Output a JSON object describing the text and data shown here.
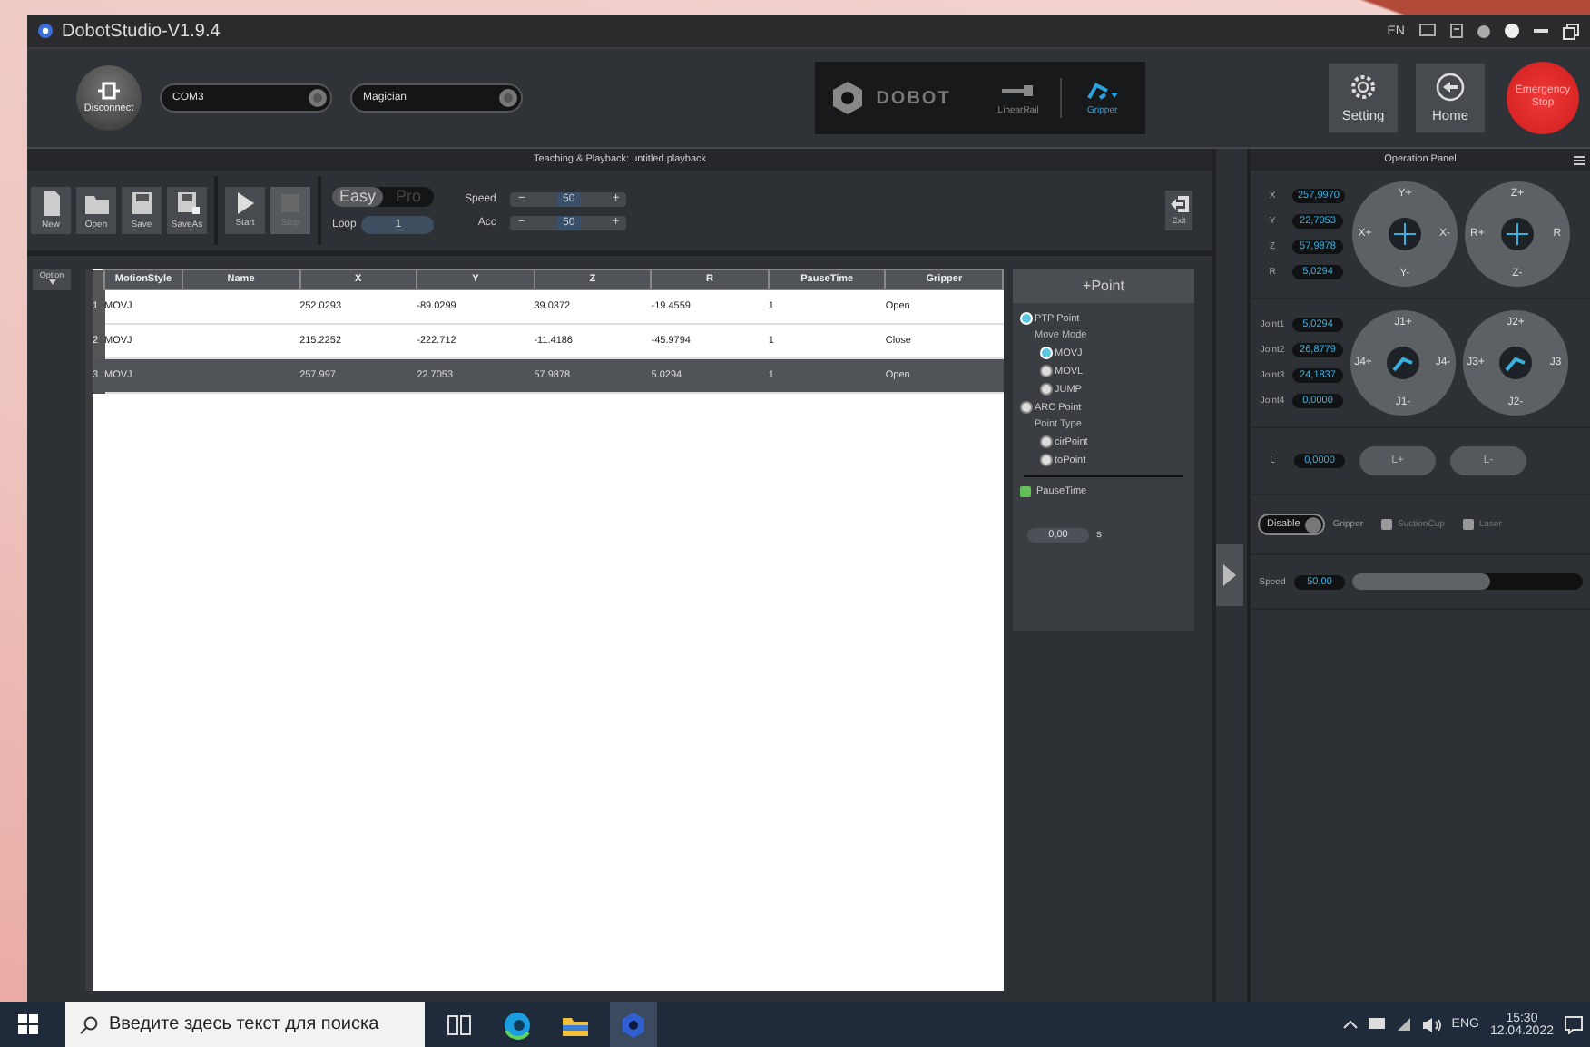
{
  "window": {
    "title": "DobotStudio-V1.9.4",
    "language": "EN"
  },
  "toolbar": {
    "connect_button": "Disconnect",
    "port": "COM3",
    "device": "Magician",
    "brand": "DOBOT",
    "end_effectors": [
      {
        "label": "LinearRail",
        "kind": "rail",
        "selected": false
      },
      {
        "label": "Gripper",
        "kind": "gripper",
        "selected": true
      }
    ],
    "buttons": [
      {
        "label": "Setting",
        "kind": "gear"
      },
      {
        "label": "Home",
        "kind": "home"
      }
    ],
    "emergency_stop": "Emergency Stop"
  },
  "teaching": {
    "title": "Teaching & Playback: untitled.playback",
    "file_buttons": [
      {
        "label": "New",
        "kind": "new"
      },
      {
        "label": "Open",
        "kind": "open"
      },
      {
        "label": "Save",
        "kind": "save"
      },
      {
        "label": "SaveAs",
        "kind": "saveas"
      }
    ],
    "run_buttons": [
      {
        "label": "Start",
        "kind": "play",
        "disabled": false
      },
      {
        "label": "Stop",
        "kind": "stop",
        "disabled": true
      }
    ],
    "modes": [
      {
        "label": "Easy",
        "selected": true
      },
      {
        "label": "Pro",
        "selected": false
      }
    ],
    "loop": {
      "label": "Loop",
      "value": "1"
    },
    "steppers": [
      {
        "label": "Speed",
        "minus": "−",
        "value": "50",
        "plus": "+"
      },
      {
        "label": "Acc",
        "minus": "−",
        "value": "50",
        "plus": "+"
      }
    ],
    "exit": "Exit",
    "option": "Option",
    "table": {
      "columns": [
        "MotionStyle",
        "Name",
        "X",
        "Y",
        "Z",
        "R",
        "PauseTime",
        "Gripper"
      ],
      "rows": [
        {
          "index": "1",
          "cells": [
            "MOVJ",
            "",
            "252.0293",
            "-89.0299",
            "39.0372",
            "-19.4559",
            "1",
            "Open"
          ],
          "selected": false
        },
        {
          "index": "2",
          "cells": [
            "MOVJ",
            "",
            "215.2252",
            "-222.712",
            "-11.4186",
            "-45.9794",
            "1",
            "Close"
          ],
          "selected": false
        },
        {
          "index": "3",
          "cells": [
            "MOVJ",
            "",
            "257.997",
            "22.7053",
            "57.9878",
            "5.0294",
            "1",
            "Open"
          ],
          "selected": true
        }
      ]
    },
    "point_panel": {
      "add_button": "+Point",
      "groups": [
        {
          "label": "PTP Point",
          "selected": true,
          "caption": "Move Mode",
          "children": [
            {
              "label": "MOVJ",
              "selected": true
            },
            {
              "label": "MOVL",
              "selected": false
            },
            {
              "label": "JUMP",
              "selected": false
            }
          ]
        },
        {
          "label": "ARC Point",
          "selected": false,
          "caption": "Point Type",
          "children": [
            {
              "label": "cirPoint",
              "selected": false
            },
            {
              "label": "toPoint",
              "selected": false
            }
          ]
        }
      ],
      "pause": {
        "label": "PauseTime",
        "checked": true,
        "value": "0,00",
        "unit": "s"
      }
    }
  },
  "operation_panel": {
    "title": "Operation Panel",
    "coords": [
      {
        "label": "X",
        "value": "257,9970"
      },
      {
        "label": "Y",
        "value": "22,7053"
      },
      {
        "label": "Z",
        "value": "57,9878"
      },
      {
        "label": "R",
        "value": "5,0294"
      }
    ],
    "coord_wheels": [
      {
        "top": "Y+",
        "left": "X+",
        "right": "X-",
        "bottom": "Y-"
      },
      {
        "top": "Z+",
        "left": "R+",
        "right": "R",
        "bottom": "Z-"
      }
    ],
    "joints": [
      {
        "label": "Joint1",
        "value": "5,0294"
      },
      {
        "label": "Joint2",
        "value": "26,8779"
      },
      {
        "label": "Joint3",
        "value": "24,1837"
      },
      {
        "label": "Joint4",
        "value": "0,0000"
      }
    ],
    "joint_wheels": [
      {
        "top": "J1+",
        "left": "J4+",
        "right": "J4-",
        "bottom": "J1-"
      },
      {
        "top": "J2+",
        "left": "J3+",
        "right": "J3",
        "bottom": "J2-"
      }
    ],
    "rail": {
      "label": "L",
      "value": "0,0000",
      "buttons": [
        "L+",
        "L-"
      ]
    },
    "gripper": {
      "toggle": "Disable",
      "on": false,
      "label": "Gripper",
      "options": [
        {
          "label": "SuctionCup",
          "checked": false
        },
        {
          "label": "Laser",
          "checked": false
        }
      ]
    },
    "speed": {
      "label": "Speed",
      "value": "50,00",
      "level": 0.6
    }
  },
  "taskbar": {
    "search_placeholder": "Введите здесь текст для поиска",
    "apps": [
      {
        "kind": "taskview",
        "selected": false
      },
      {
        "kind": "edge",
        "selected": false
      },
      {
        "kind": "folder",
        "selected": false
      },
      {
        "kind": "dobot",
        "selected": true
      }
    ],
    "language": "ENG",
    "time": "15:30",
    "date": "12.04.2022"
  }
}
